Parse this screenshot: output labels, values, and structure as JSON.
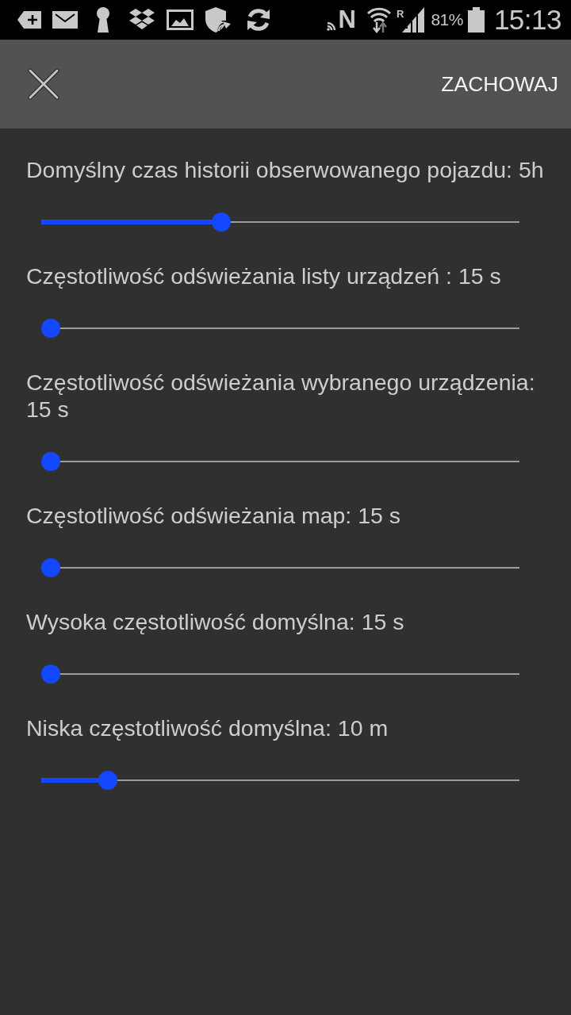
{
  "status_bar": {
    "nfc": "N",
    "roaming": "R",
    "battery_percent": "81%",
    "time": "15:13"
  },
  "toolbar": {
    "action": "ZACHOWAJ"
  },
  "settings": [
    {
      "label": "Domyślny czas historii obserwowanego pojazdu: 5h",
      "level": 0.364
    },
    {
      "label": "Częstotliwość odświeżania listy urządzeń : 15 s",
      "level": 0
    },
    {
      "label": "Częstotliwość odświeżania wybranego urządzenia: 15 s",
      "level": 0
    },
    {
      "label": "Częstotliwość odświeżania map: 15 s",
      "level": 0
    },
    {
      "label": "Wysoka częstotliwość domyślna: 15 s",
      "level": 0
    },
    {
      "label": "Niska częstotliwość domyślna: 10 m",
      "level": 0.122
    }
  ]
}
